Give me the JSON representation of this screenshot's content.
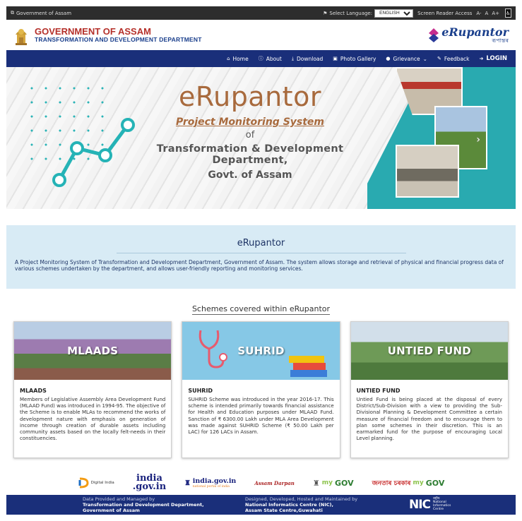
{
  "topbar": {
    "gov_link": "Government of Assam",
    "select_language_label": "Select Language:",
    "language_value": "ENGLISH",
    "screen_reader": "Screen Reader Access",
    "font_small": "A-",
    "font_normal": "A",
    "font_large": "A+"
  },
  "header": {
    "title1": "GOVERNMENT OF ASSAM",
    "title2": "TRANSFORMATION AND DEVELOPMENT DEPARTMENT",
    "brand": "eRupantor",
    "brand_sub": "ৰূপান্তৰ"
  },
  "nav": {
    "items": [
      {
        "label": "Home",
        "icon": "home-icon"
      },
      {
        "label": "About",
        "icon": "info-icon"
      },
      {
        "label": "Download",
        "icon": "download-icon"
      },
      {
        "label": "Photo Gallery",
        "icon": "image-icon"
      },
      {
        "label": "Grievance",
        "icon": "chat-icon"
      },
      {
        "label": "Feedback",
        "icon": "edit-icon"
      }
    ],
    "grievance_caret": "⌄",
    "login": "LOGIN"
  },
  "banner": {
    "title": "eRupantor",
    "subtitle": "Project Monitoring System",
    "of": "of",
    "dept": "Transformation & Development Department,",
    "govt": "Govt. of Assam"
  },
  "intro": {
    "heading": "eRupantor",
    "text": "A Project Monitoring System of Transformation and Development Department, Government of Assam. The system allows storage and retrieval of physical and financial progress data of various schemes undertaken by the department, and allows user-friendly reporting and monitoring services."
  },
  "schemes": {
    "title": "Schemes covered within eRupantor",
    "cards": [
      {
        "image_label": "MLAADS",
        "heading": "MLAADS",
        "text": "Members of Legislative Assembly Area Development Fund (MLAAD Fund) was introduced in 1994-95. The objective of the Scheme is to enable MLAs to recommend the works of development nature with emphasis on generation of income through creation of durable assets including community assets based on the locally felt-needs in their constituencies."
      },
      {
        "image_label": "SUHRID",
        "heading": "SUHRID",
        "text": "SUHRID Scheme was introduced in the year 2016-17. This scheme is intended primarily towards financial assistance for Health and Education purposes under MLAAD Fund. Sanction of ₹ 6300.00 Lakh under MLA Area Development was made against SUHRID Scheme (₹ 50.00 Lakh per LAC) for 126 LACs in Assam."
      },
      {
        "image_label": "UNTIED FUND",
        "heading": "UNTIED FUND",
        "text": "Untied Fund is being placed at the disposal of every District/Sub-Division with a view to providing the Sub-Divisional Planning & Development Committee a certain measure of financial freedom and to encourage them to plan some schemes in their discretion. This is an earmarked fund for the purpose of encouraging Local Level planning."
      }
    ]
  },
  "partners": {
    "digital_india": "Digital India",
    "india_gov_line1": "india",
    "india_gov_line2": ".gov.in",
    "igov": "india.gov.in",
    "igov_sub": "national portal of india",
    "assam_darpan": "Assam Darpan",
    "mygov": "GOV",
    "mygov_my": "my",
    "jb": "জনতাৰ চৰকাৰ"
  },
  "footer": {
    "managed_label": "Data Provided and Managed by",
    "managed_line1": "Transformation and Development Department,",
    "managed_line2": "Government of Assam",
    "designed_label": "Designed, Developed, Hosted and Maintained by",
    "designed_line1": "National Informatics Centre (NIC),",
    "designed_line2": "Assam State Centre,Guwahati",
    "nic": "NIC",
    "nic_sub1": "राष्ट्रीय",
    "nic_sub2": "National",
    "nic_sub3": "Informatics",
    "nic_sub4": "Centre"
  }
}
